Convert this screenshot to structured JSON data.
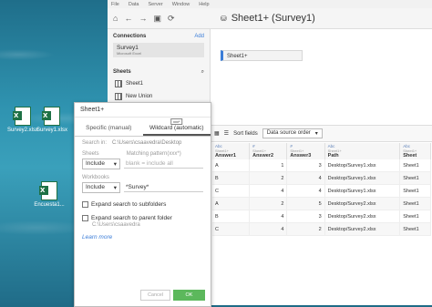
{
  "desktop": {
    "icons": [
      {
        "label": "Survey2.xlsx"
      },
      {
        "label": "Survey1.xlsx"
      },
      {
        "label": "Encuesta1..."
      }
    ]
  },
  "app": {
    "menu": [
      "File",
      "Data",
      "Server",
      "Window",
      "Help"
    ],
    "title": "Sheet1+ (Survey1)",
    "connections_header": "Connections",
    "add_label": "Add",
    "connection": {
      "name": "Survey1",
      "type": "Microsoft Excel"
    },
    "sheets_header": "Sheets",
    "sheets": [
      "Sheet1",
      "New Union"
    ],
    "canvas_table": "Sheet1+",
    "sort_label": "Sort fields",
    "sort_value": "Data source order",
    "grid": {
      "columns": [
        {
          "type": "Abc",
          "source": "Sheet1+",
          "name": "Answer1"
        },
        {
          "type": "#",
          "source": "Sheet1+",
          "name": "Answer2"
        },
        {
          "type": "#",
          "source": "Sheet1+",
          "name": "Answer3"
        },
        {
          "type": "Abc",
          "source": "Sheet1+",
          "name": "Path"
        },
        {
          "type": "Abc",
          "source": "Sheet1+",
          "name": "Sheet"
        }
      ],
      "rows": [
        [
          "A",
          "1",
          "3",
          "Desktop/Survey1.xlsx",
          "Sheet1"
        ],
        [
          "B",
          "2",
          "4",
          "Desktop/Survey1.xlsx",
          "Sheet1"
        ],
        [
          "C",
          "4",
          "4",
          "Desktop/Survey1.xlsx",
          "Sheet1"
        ],
        [
          "A",
          "2",
          "5",
          "Desktop/Survey2.xlsx",
          "Sheet1"
        ],
        [
          "B",
          "4",
          "3",
          "Desktop/Survey2.xlsx",
          "Sheet1"
        ],
        [
          "C",
          "4",
          "2",
          "Desktop/Survey2.xlsx",
          "Sheet1"
        ]
      ]
    }
  },
  "dialog": {
    "title": "Sheet1+",
    "tab_specific": "Specific (manual)",
    "tab_wildcard": "Wildcard (automatic)",
    "wildcard_icon_text": "xxx*",
    "search_in_label": "Search in:",
    "search_in_value": "C:\\Users\\csaavedra\\Desktop",
    "sheets_label": "Sheets",
    "matching_label": "Matching pattern(xxx*)",
    "sheets_mode": "Include",
    "sheets_pattern_placeholder": "blank = include all",
    "workbooks_label": "Workbooks",
    "workbooks_mode": "Include",
    "workbooks_pattern": "*Survey*",
    "expand_subfolders": "Expand search to subfolders",
    "expand_parent": "Expand search to parent folder",
    "parent_path": "C:\\Users\\csaavedra",
    "learn_more": "Learn more",
    "cancel_label": "Cancel",
    "ok_label": "OK"
  }
}
